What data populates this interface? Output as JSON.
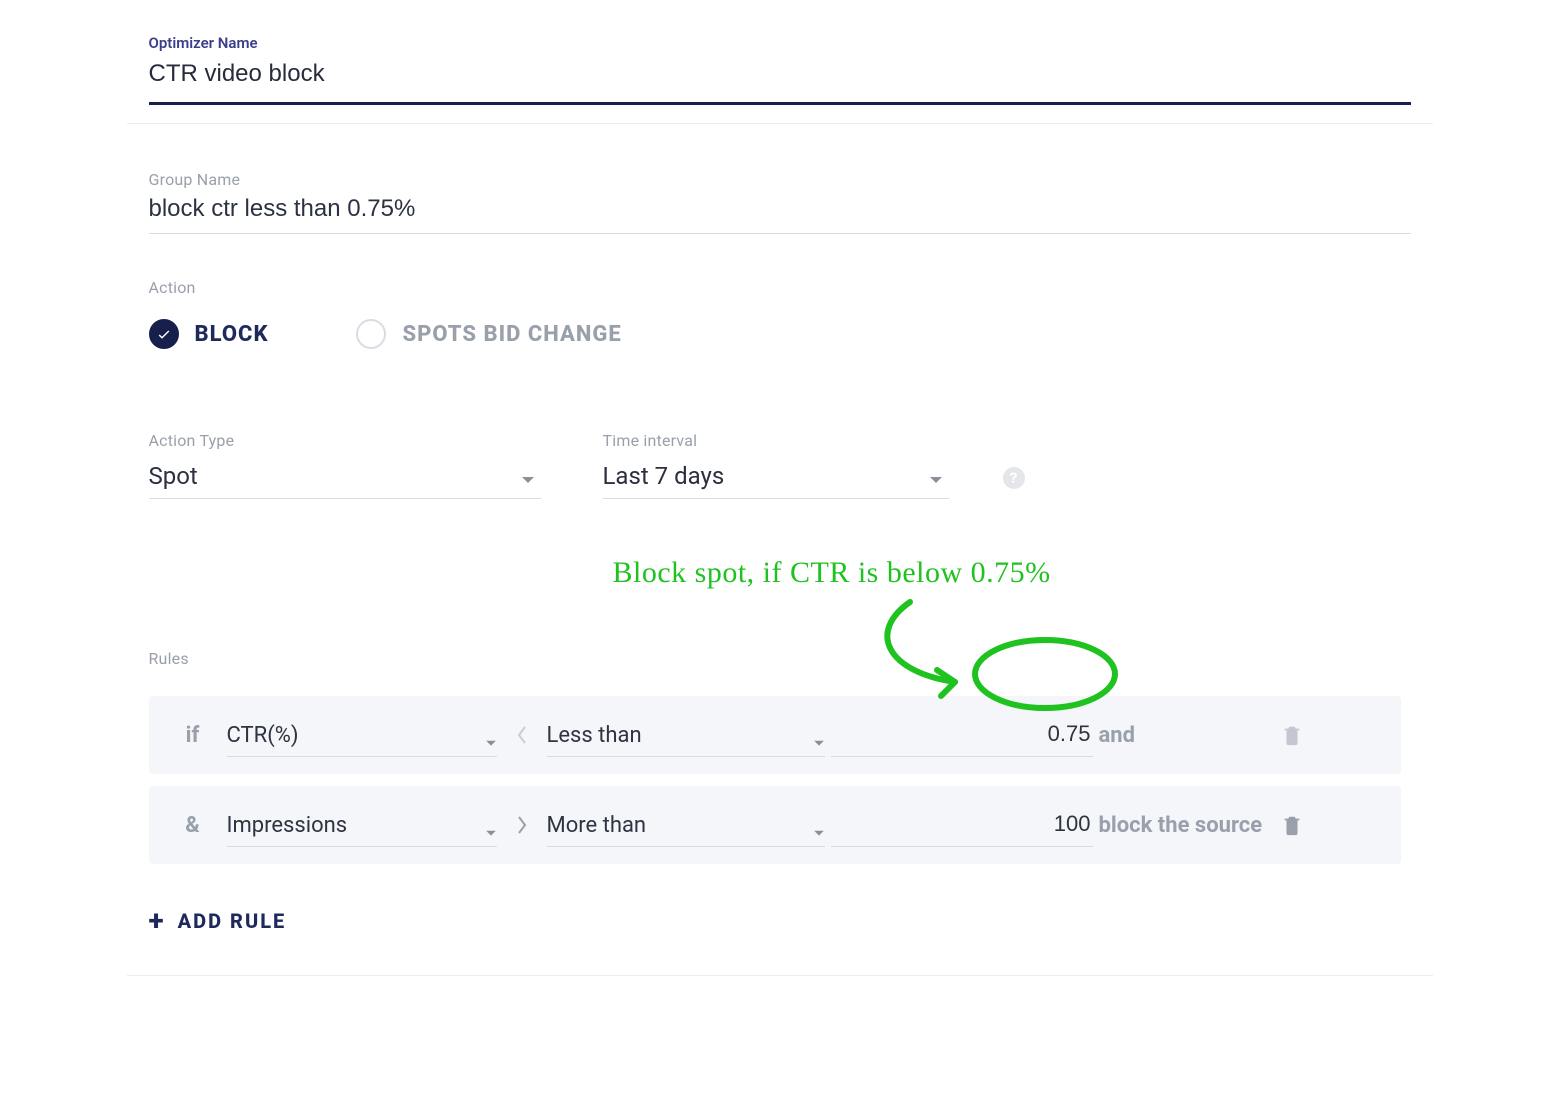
{
  "optimizer": {
    "label": "Optimizer Name",
    "value": "CTR video block"
  },
  "group": {
    "label": "Group Name",
    "value": "block ctr less than 0.75%"
  },
  "action": {
    "label": "Action",
    "options": {
      "block": "BLOCK",
      "spots": "SPOTS BID CHANGE"
    },
    "selected": "block"
  },
  "actionType": {
    "label": "Action Type",
    "value": "Spot"
  },
  "timeInterval": {
    "label": "Time interval",
    "value": "Last 7 days"
  },
  "rules": {
    "label": "Rules",
    "items": [
      {
        "prefix": "if",
        "metric": "CTR(%)",
        "dir": "left",
        "op": "Less than",
        "value": "0.75",
        "tail": "and"
      },
      {
        "prefix": "&",
        "metric": "Impressions",
        "dir": "right",
        "op": "More than",
        "value": "100",
        "tail": "block the source"
      }
    ]
  },
  "addRule": {
    "label": "ADD RULE"
  },
  "annotation": {
    "text": "Block spot, if CTR is below 0.75%"
  }
}
